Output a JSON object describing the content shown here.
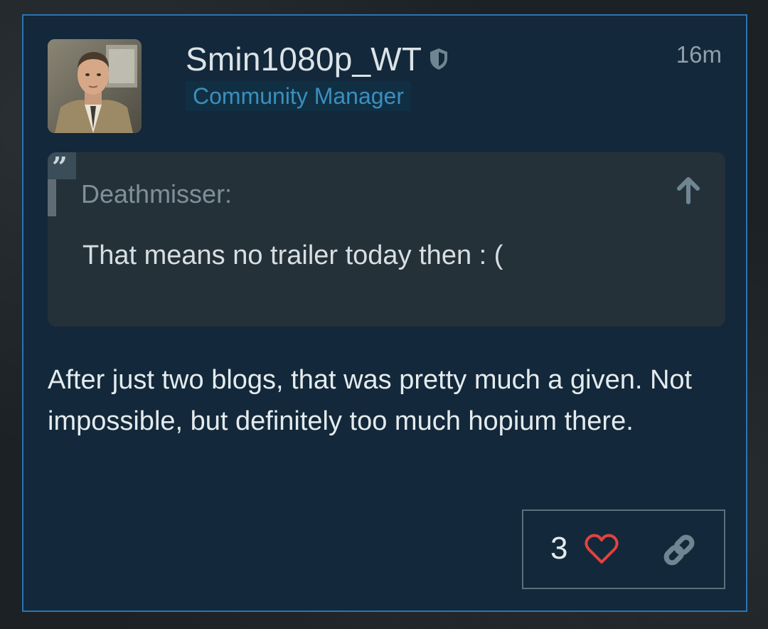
{
  "post": {
    "author": {
      "username": "Smin1080p_WT",
      "title": "Community Manager",
      "avatar_icon": "avatar-portrait",
      "badge_icon": "shield-icon"
    },
    "time": "16m",
    "quote": {
      "author": "Deathmisser:",
      "text": "That means no trailer today then : (",
      "quote_icon": "quote-icon",
      "jump_icon": "arrow-up-icon"
    },
    "body": "After just two blogs, that was pretty much a given. Not impossible, but definitely too much hopium there.",
    "actions": {
      "like_count": "3",
      "like_icon": "heart-icon",
      "share_icon": "link-icon"
    }
  },
  "colors": {
    "accent_border": "#2a75b4",
    "panel": "#13283a",
    "title_text": "#3a8fbf",
    "heart": "#e0443e"
  }
}
